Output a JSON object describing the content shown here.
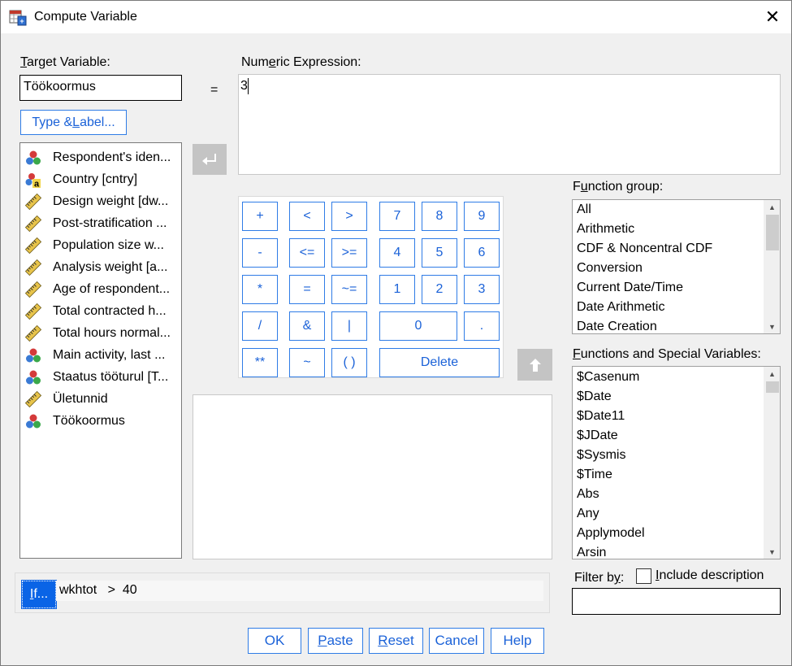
{
  "window": {
    "title": "Compute Variable",
    "close_glyph": "✕"
  },
  "target": {
    "label_pre": "",
    "label_u": "T",
    "label_post": "arget Variable:",
    "value": "Töökoormus",
    "equals": "="
  },
  "type_label_btn": {
    "pre": "Type & ",
    "u": "L",
    "post": "abel..."
  },
  "expression": {
    "label_pre": "Num",
    "label_u": "e",
    "label_post": "ric Expression:",
    "value": "3"
  },
  "variables": [
    {
      "label": "Respondent's iden...",
      "icon": "nominal-icon"
    },
    {
      "label": "Country [cntry]",
      "icon": "string-nominal-icon"
    },
    {
      "label": "Design weight [dw...",
      "icon": "scale-icon"
    },
    {
      "label": "Post-stratification ...",
      "icon": "scale-icon"
    },
    {
      "label": "Population size w...",
      "icon": "scale-icon"
    },
    {
      "label": "Analysis weight [a...",
      "icon": "scale-icon"
    },
    {
      "label": "Age of respondent...",
      "icon": "scale-icon"
    },
    {
      "label": "Total contracted h...",
      "icon": "scale-icon"
    },
    {
      "label": "Total hours normal...",
      "icon": "scale-icon"
    },
    {
      "label": "Main activity, last ...",
      "icon": "nominal-icon"
    },
    {
      "label": "Staatus tööturul [T...",
      "icon": "nominal-icon"
    },
    {
      "label": "Ületunnid",
      "icon": "scale-icon"
    },
    {
      "label": "Töökoormus",
      "icon": "nominal-icon"
    }
  ],
  "keypad": {
    "plus": "+",
    "lt": "<",
    "gt": ">",
    "k7": "7",
    "k8": "8",
    "k9": "9",
    "minus": "-",
    "le": "<=",
    "ge": ">=",
    "k4": "4",
    "k5": "5",
    "k6": "6",
    "mul": "*",
    "eq": "=",
    "ne": "~=",
    "k1": "1",
    "k2": "2",
    "k3": "3",
    "div": "/",
    "and": "&",
    "or": "|",
    "k0": "0",
    "dot": ".",
    "pow": "**",
    "not": "~",
    "paren": "( )",
    "delete": "Delete"
  },
  "function_group": {
    "label_pre": "F",
    "label_u": "u",
    "label_post": "nction group:",
    "items": [
      "All",
      "Arithmetic",
      "CDF & Noncentral CDF",
      "Conversion",
      "Current Date/Time",
      "Date Arithmetic",
      "Date Creation"
    ]
  },
  "functions": {
    "label_pre": "",
    "label_u": "F",
    "label_post": "unctions and Special Variables:",
    "items": [
      "$Casenum",
      "$Date",
      "$Date11",
      "$JDate",
      "$Sysmis",
      "$Time",
      "Abs",
      "Any",
      "Applymodel",
      "Arsin"
    ]
  },
  "if_section": {
    "btn_u": "I",
    "btn_post": "f...",
    "condition": "wkhtot   >  40"
  },
  "filter": {
    "label_pre": "Filter b",
    "label_u": "y",
    "label_post": ":",
    "checkbox_pre": "",
    "checkbox_u": "I",
    "checkbox_post": "nclude description",
    "value": ""
  },
  "buttons": {
    "ok": "OK",
    "paste_u": "P",
    "paste_post": "aste",
    "reset_u": "R",
    "reset_post": "eset",
    "cancel": "Cancel",
    "help": "Help"
  },
  "colors": {
    "accent": "#1b62d8",
    "selected": "#0a64e6",
    "arrow_bg": "#c4c4c4"
  }
}
